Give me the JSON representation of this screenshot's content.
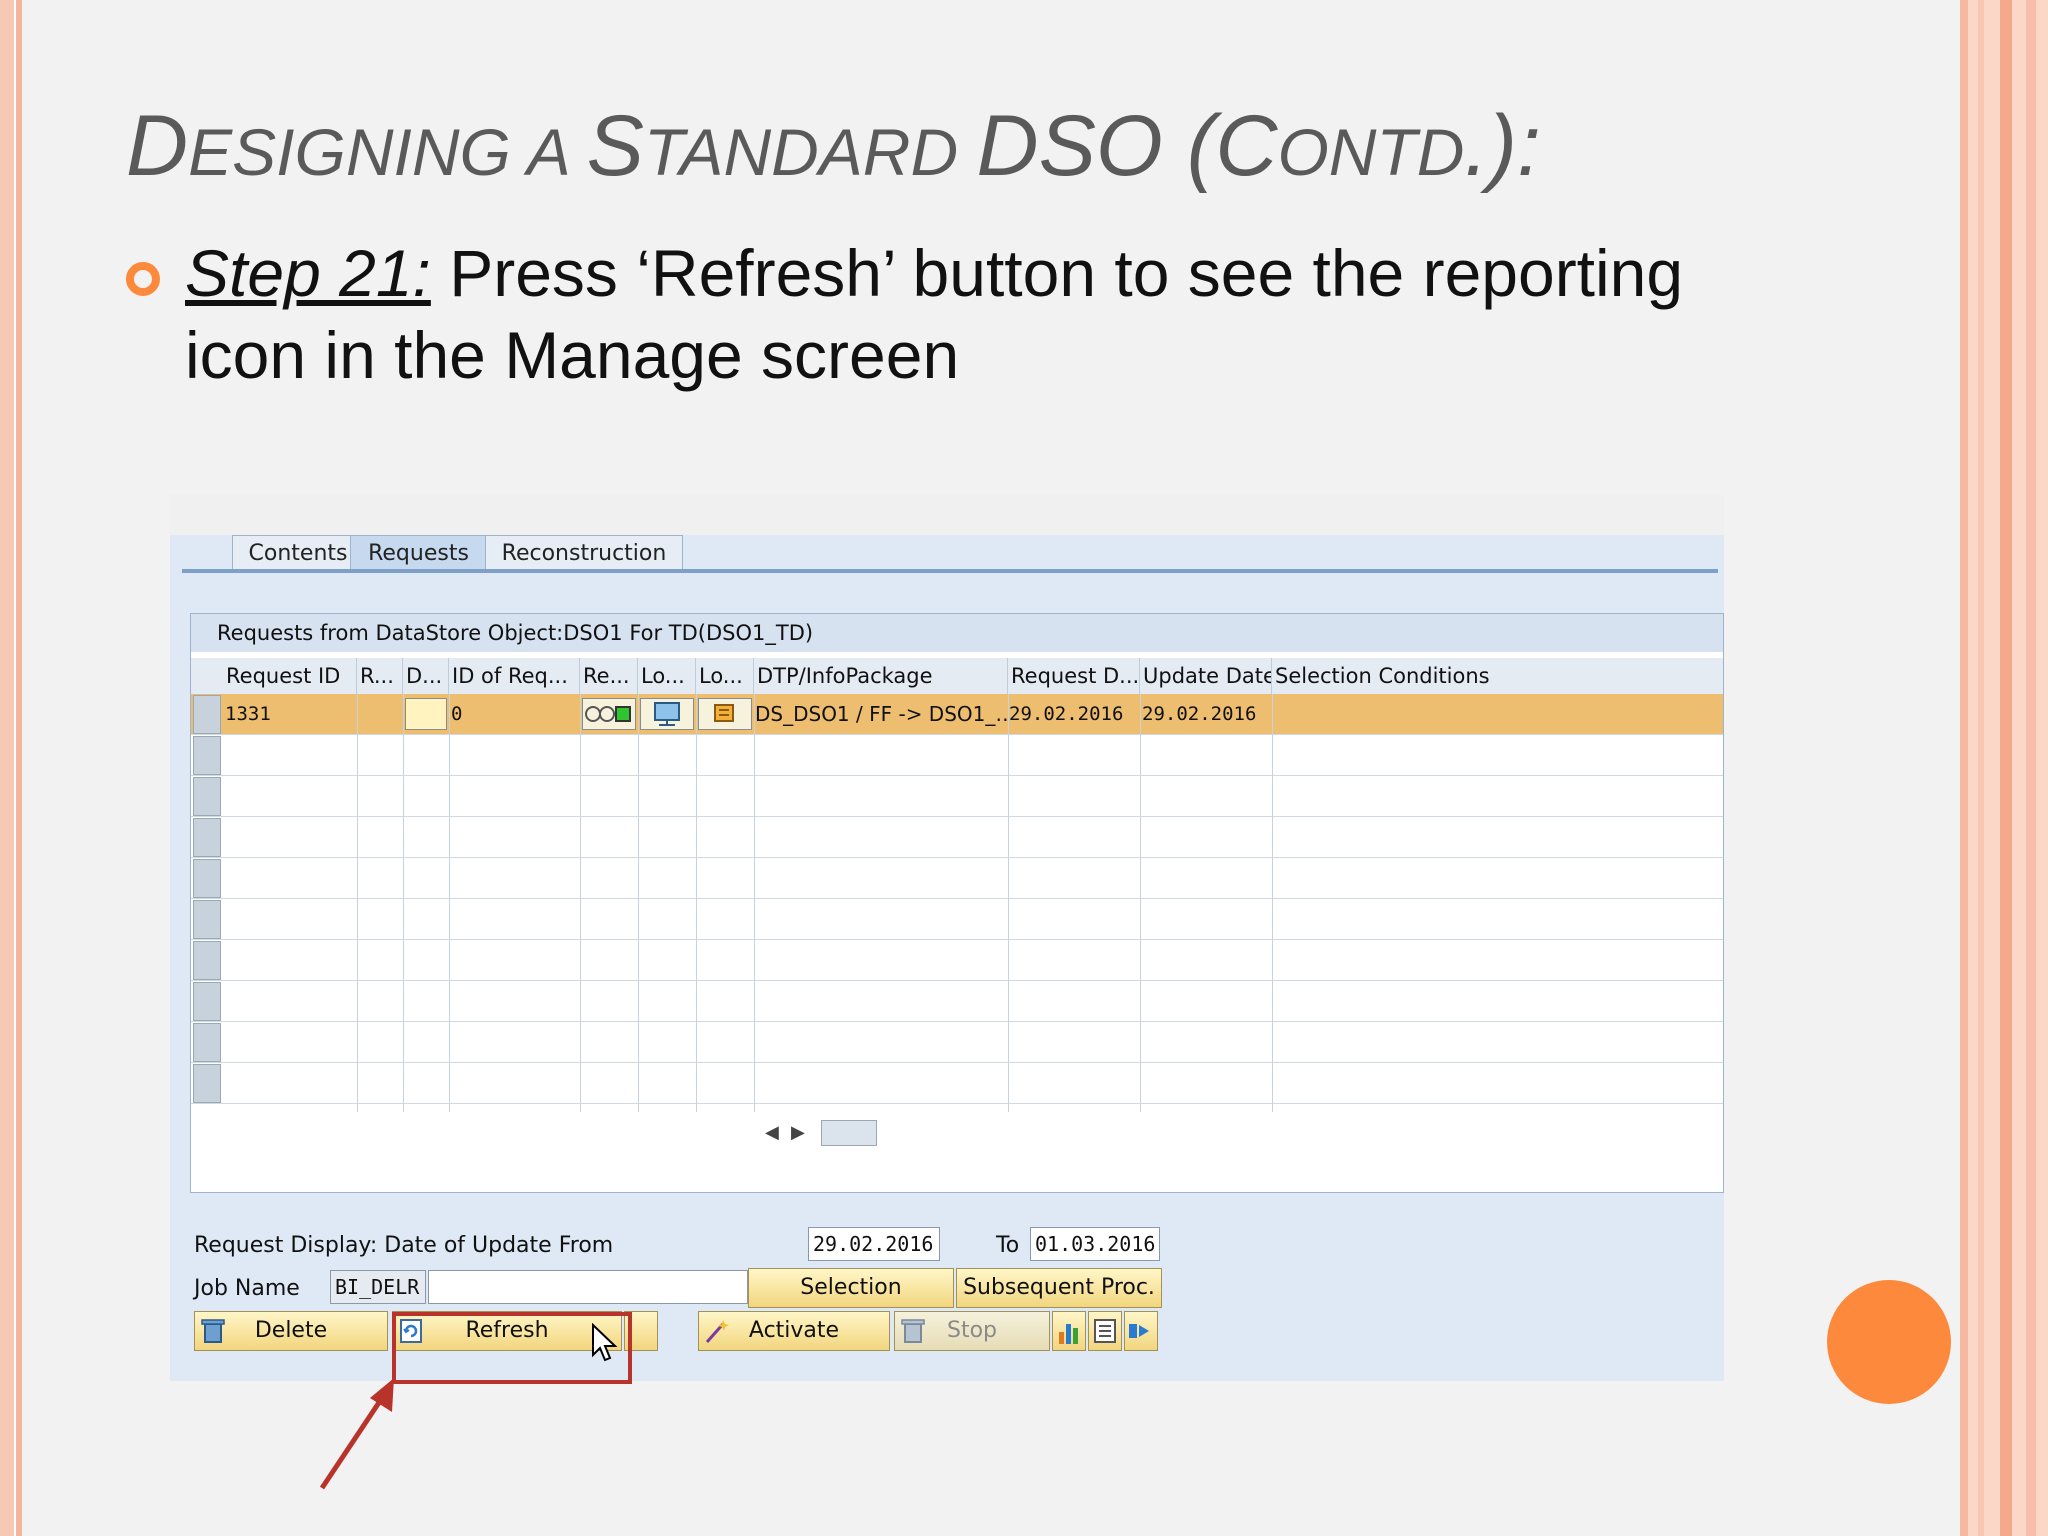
{
  "slide": {
    "title_parts": [
      {
        "big": "D",
        "small": "ESIGNING "
      },
      {
        "big": "",
        "small": "A "
      },
      {
        "big": "S",
        "small": "TANDARD "
      },
      {
        "big": "DSO (C",
        "small": "ONTD"
      },
      {
        "big": ".):",
        "small": ""
      }
    ],
    "step_label": "Step 21:",
    "step_text": " Press ‘Refresh’ button to see the reporting icon in the Manage screen"
  },
  "sap": {
    "tabs": [
      "Contents",
      "Requests",
      "Reconstruction"
    ],
    "active_tab": "Requests",
    "panel_title": "Requests from DataStore Object:DSO1 For TD(DSO1_TD)",
    "columns": [
      "Request ID",
      "R...",
      "D...",
      "ID of Req...",
      "Re...",
      "Lo...",
      "Lo...",
      "DTP/InfoPackage",
      "Request D...",
      "Update Date",
      "Selection Conditions"
    ],
    "rows": [
      {
        "request_id": "1331",
        "id_of_req": "0",
        "dtp": "DS_DSO1 / FF -> DSO1_…",
        "request_date": "29.02.2016",
        "update_date": "29.02.2016"
      }
    ],
    "date_label": "Request Display: Date of Update From",
    "date_from": "29.02.2016",
    "to_label": "To",
    "date_to": "01.03.2016",
    "job_label": "Job Name",
    "job_value": "BI_DELR",
    "buttons": {
      "selection": "Selection",
      "subsequent": "Subsequent Proc.",
      "delete": "Delete",
      "refresh": "Refresh",
      "activate": "Activate",
      "stop": "Stop"
    },
    "colors": {
      "selected_row": "#edbe70",
      "highlight": "#b8342a",
      "accent": "#fd8a3c"
    }
  }
}
